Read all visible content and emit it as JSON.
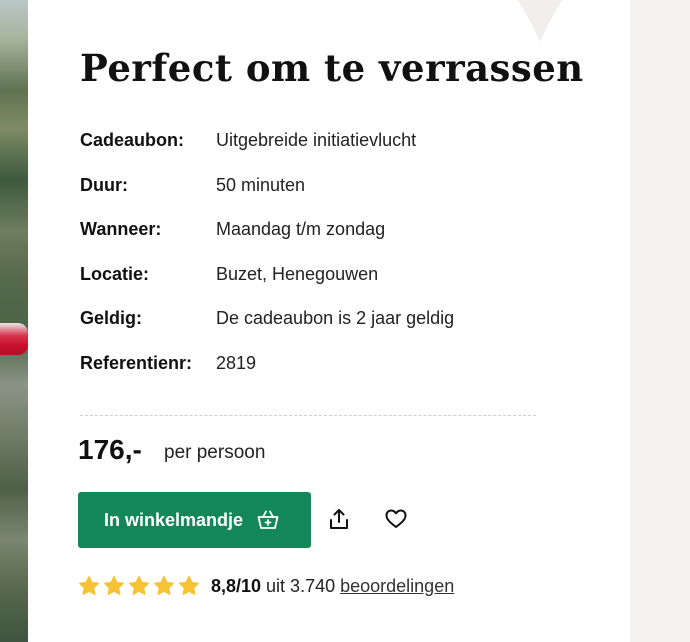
{
  "title": "Perfect om te verrassen",
  "details": [
    {
      "label": "Cadeaubon:",
      "value": "Uitgebreide initiatievlucht"
    },
    {
      "label": "Duur:",
      "value": "50 minuten"
    },
    {
      "label": "Wanneer:",
      "value": "Maandag t/m zondag"
    },
    {
      "label": "Locatie:",
      "value": "Buzet, Henegouwen"
    },
    {
      "label": "Geldig:",
      "value": "De cadeaubon is 2 jaar geldig"
    },
    {
      "label": "Referentienr:",
      "value": "2819"
    }
  ],
  "price": {
    "amount": "176,-",
    "unit": "per persoon"
  },
  "actions": {
    "cart_label": "In winkelmandje",
    "cart_icon": "basket-icon",
    "share_icon": "share-icon",
    "favorite_icon": "heart-icon"
  },
  "rating": {
    "stars_filled": 5,
    "stars_total": 5,
    "score": "8,8/10",
    "count_text": "uit 3.740",
    "reviews_label": "beoordelingen"
  },
  "colors": {
    "accent_green": "#14875a",
    "star_yellow": "#f7c233",
    "badge_pink": "#d4145a"
  }
}
